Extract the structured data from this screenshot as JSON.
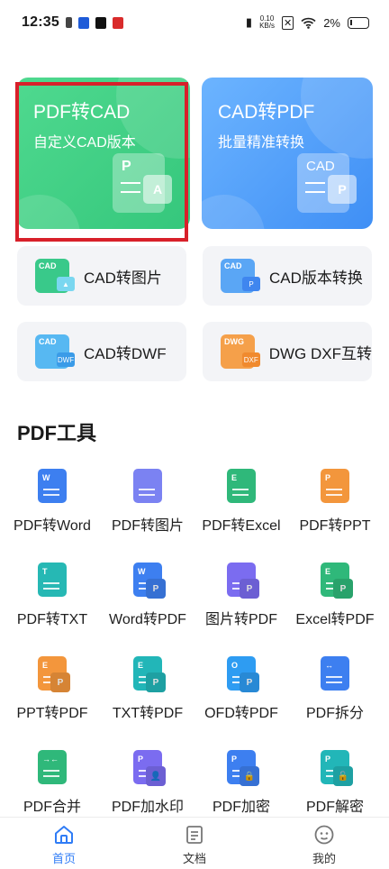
{
  "status_bar": {
    "time": "12:35",
    "net_speed_value": "0.10",
    "net_speed_unit": "KB/s",
    "battery": "2%"
  },
  "hero_cards": [
    {
      "title": "PDF转CAD",
      "subtitle": "自定义CAD版本",
      "doc_letter": "P",
      "badge": "A"
    },
    {
      "title": "CAD转PDF",
      "subtitle": "批量精准转换",
      "doc_letter": "CAD",
      "badge": "P"
    }
  ],
  "quick_tools": [
    {
      "label": "CAD转图片",
      "icon_text": "CAD",
      "badge": "▲",
      "color": "#39c98a",
      "badge_color": "#7ad7f0"
    },
    {
      "label": "CAD版本转换",
      "icon_text": "CAD",
      "badge": "P",
      "color": "#5aa6f5",
      "badge_color": "#3f86ef"
    },
    {
      "label": "CAD转DWF",
      "icon_text": "CAD",
      "badge": "DWF",
      "color": "#57b8f2",
      "badge_color": "#3a9be8"
    },
    {
      "label": "DWG DXF互转",
      "icon_text": "DWG",
      "badge": "DXF",
      "color": "#f5a04a",
      "badge_color": "#f08a2e"
    }
  ],
  "section_title": "PDF工具",
  "pdf_tools": [
    {
      "label": "PDF转Word",
      "icon_text": "W",
      "badge": "",
      "color": "#3d7ff0"
    },
    {
      "label": "PDF转图片",
      "icon_text": "",
      "badge": "",
      "color": "#7b82f2"
    },
    {
      "label": "PDF转Excel",
      "icon_text": "E",
      "badge": "",
      "color": "#2fb87a"
    },
    {
      "label": "PDF转PPT",
      "icon_text": "P",
      "badge": "",
      "color": "#f3963c"
    },
    {
      "label": "PDF转TXT",
      "icon_text": "T",
      "badge": "",
      "color": "#26b8b4"
    },
    {
      "label": "Word转PDF",
      "icon_text": "W",
      "badge": "P",
      "color": "#3d7ff0"
    },
    {
      "label": "图片转PDF",
      "icon_text": "",
      "badge": "P",
      "color": "#7b6cf0"
    },
    {
      "label": "Excel转PDF",
      "icon_text": "E",
      "badge": "P",
      "color": "#2fb87a"
    },
    {
      "label": "PPT转PDF",
      "icon_text": "E",
      "badge": "P",
      "color": "#f3963c"
    },
    {
      "label": "TXT转PDF",
      "icon_text": "E",
      "badge": "P",
      "color": "#22b6b8"
    },
    {
      "label": "OFD转PDF",
      "icon_text": "O",
      "badge": "P",
      "color": "#2e9cf2"
    },
    {
      "label": "PDF拆分",
      "icon_text": "↔",
      "badge": "",
      "color": "#3d7ff0"
    },
    {
      "label": "PDF合并",
      "icon_text": "→←",
      "badge": "",
      "color": "#2fb87a"
    },
    {
      "label": "PDF加水印",
      "icon_text": "P",
      "badge": "👤",
      "color": "#7b6cf0"
    },
    {
      "label": "PDF加密",
      "icon_text": "P",
      "badge": "🔒",
      "color": "#3d7ff0"
    },
    {
      "label": "PDF解密",
      "icon_text": "P",
      "badge": "🔓",
      "color": "#22b6b8"
    }
  ],
  "bottom_nav": [
    {
      "label": "首页",
      "icon": "home-icon",
      "active": true
    },
    {
      "label": "文档",
      "icon": "document-icon",
      "active": false
    },
    {
      "label": "我的",
      "icon": "profile-icon",
      "active": false
    }
  ],
  "colors": {
    "accent": "#2f7cf6",
    "highlight": "#d8202a"
  }
}
